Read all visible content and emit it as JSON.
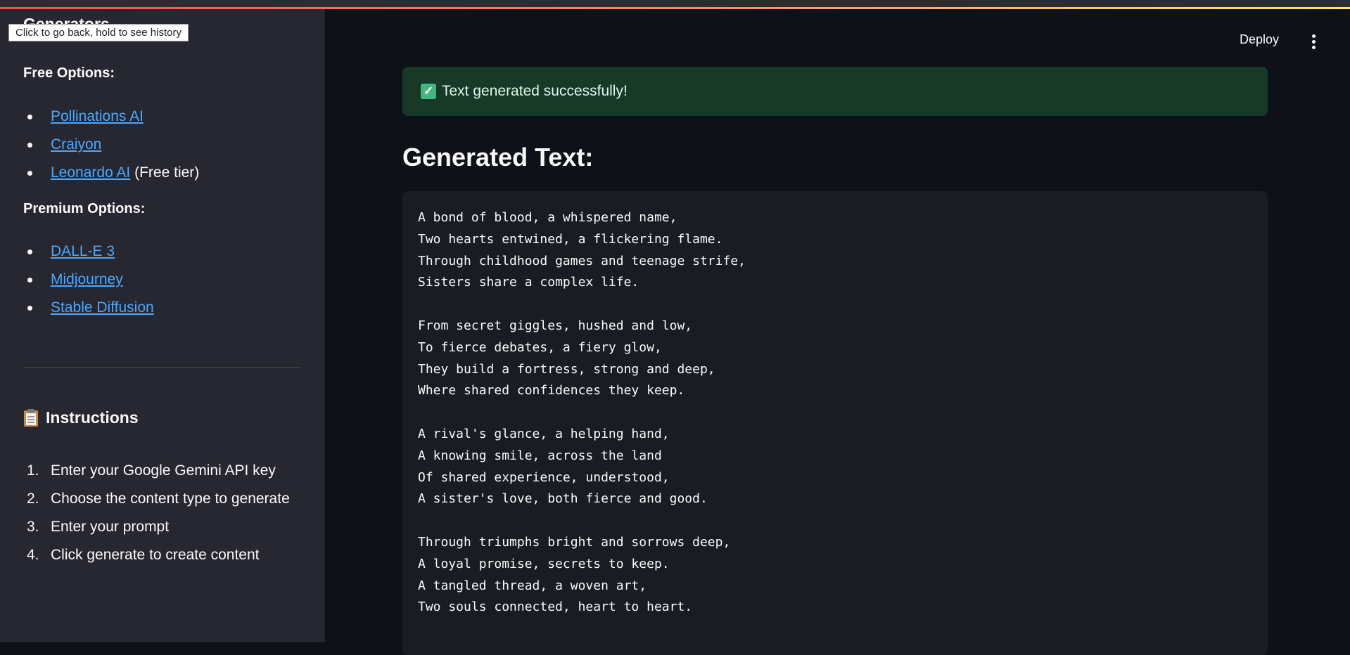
{
  "browser": {
    "tooltip": "Click to go back, hold to see history"
  },
  "sidebar": {
    "header_title": "Generators",
    "free_options_title": "Free Options:",
    "free_links": [
      {
        "label": "Pollinations AI",
        "suffix": ""
      },
      {
        "label": "Craiyon",
        "suffix": ""
      },
      {
        "label": "Leonardo AI",
        "suffix": " (Free tier)"
      }
    ],
    "premium_options_title": "Premium Options:",
    "premium_links": [
      {
        "label": "DALL-E 3"
      },
      {
        "label": "Midjourney"
      },
      {
        "label": "Stable Diffusion"
      }
    ],
    "instructions_title": "Instructions",
    "steps": [
      {
        "num": "1.",
        "text": "Enter your Google Gemini API key"
      },
      {
        "num": "2.",
        "text": "Choose the content type to generate"
      },
      {
        "num": "3.",
        "text": "Enter your prompt"
      },
      {
        "num": "4.",
        "text": "Click generate to create content"
      }
    ]
  },
  "header": {
    "deploy_label": "Deploy"
  },
  "main": {
    "success_message": "Text generated successfully!",
    "generated_title": "Generated Text:",
    "generated_text": "A bond of blood, a whispered name,\nTwo hearts entwined, a flickering flame.\nThrough childhood games and teenage strife,\nSisters share a complex life.\n\nFrom secret giggles, hushed and low,\nTo fierce debates, a fiery glow,\nThey build a fortress, strong and deep,\nWhere shared confidences they keep.\n\nA rival's glance, a helping hand,\nA knowing smile, across the land\nOf shared experience, understood,\nA sister's love, both fierce and good.\n\nThrough triumphs bright and sorrows deep,\nA loyal promise, secrets to keep.\nA tangled thread, a woven art,\nTwo souls connected, heart to heart."
  },
  "colors": {
    "background": "#0e1117",
    "sidebar": "#262730",
    "link": "#4aa8ff",
    "success_bg": "#173928",
    "code_bg": "#1a1c24"
  }
}
